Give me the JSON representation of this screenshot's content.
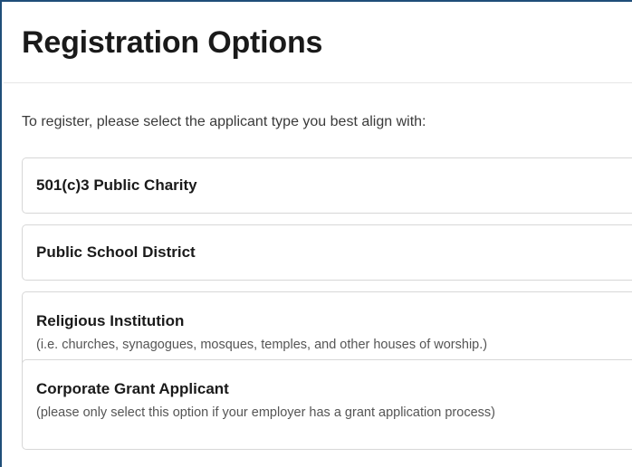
{
  "page": {
    "title": "Registration Options",
    "intro": "To register, please select the applicant type you best align with:"
  },
  "options": [
    {
      "label": "501(c)3 Public Charity",
      "description": ""
    },
    {
      "label": "Public School District",
      "description": ""
    },
    {
      "label": "Religious Institution",
      "description": "(i.e. churches, synagogues, mosques, temples, and other houses of worship.)"
    },
    {
      "label": "Corporate Grant Applicant",
      "description": "(please only select this option if your employer has a grant application process)"
    }
  ],
  "colors": {
    "frame_border": "#1f4e79",
    "card_border": "#d7d7d7",
    "heading_text": "#1a1a1a",
    "muted_text": "#555555"
  }
}
